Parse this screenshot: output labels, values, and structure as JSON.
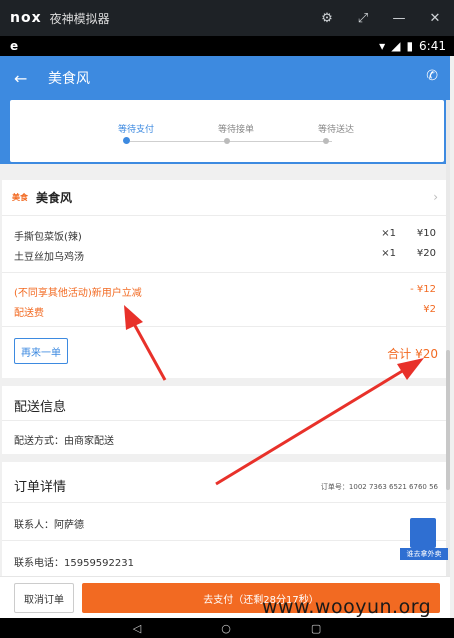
{
  "emulator": {
    "logo": "nox",
    "title": "夜神模拟器",
    "controls": [
      "settings-icon",
      "restore-icon",
      "minimize-icon",
      "close-icon"
    ]
  },
  "status_bar": {
    "app_icon": "e",
    "time": "6:41"
  },
  "header": {
    "title": "美食风",
    "back_icon": "back-arrow-icon",
    "phone_icon": "phone-icon"
  },
  "progress": {
    "steps": [
      {
        "label": "等待支付",
        "active": true
      },
      {
        "label": "等待接单",
        "active": false
      },
      {
        "label": "等待送达",
        "active": false
      }
    ]
  },
  "store": {
    "logo_text": "美食",
    "name": "美食风",
    "items": [
      {
        "name": "手撕包菜饭(辣)",
        "qty": "×1",
        "price": "¥10"
      },
      {
        "name": "土豆丝加乌鸡汤",
        "qty": "×1",
        "price": "¥20"
      }
    ],
    "discount": {
      "label": "(不同享其他活动)新用户立减",
      "value": "- ¥12"
    },
    "delivery_fee": {
      "label": "配送费",
      "value": "¥2"
    },
    "reorder_label": "再来一单",
    "total": "合计 ¥20"
  },
  "delivery_info": {
    "title": "配送信息",
    "method": "配送方式：由商家配送"
  },
  "order_info": {
    "title": "订单详情",
    "order_no": "订单号：1002 7363 6521 6760 56",
    "contact": "联系人：阿萨德",
    "phone": "联系电话：15959592231"
  },
  "bottom": {
    "cancel_label": "取消订单",
    "pay_label": "去支付（还剩28分17秒）"
  },
  "float_badge": {
    "label": "谁去拿外卖"
  },
  "watermark": "www.wooyun.org",
  "colors": {
    "primary": "#3d8ae0",
    "accent": "#f26a22",
    "annotation": "#e8312a"
  }
}
